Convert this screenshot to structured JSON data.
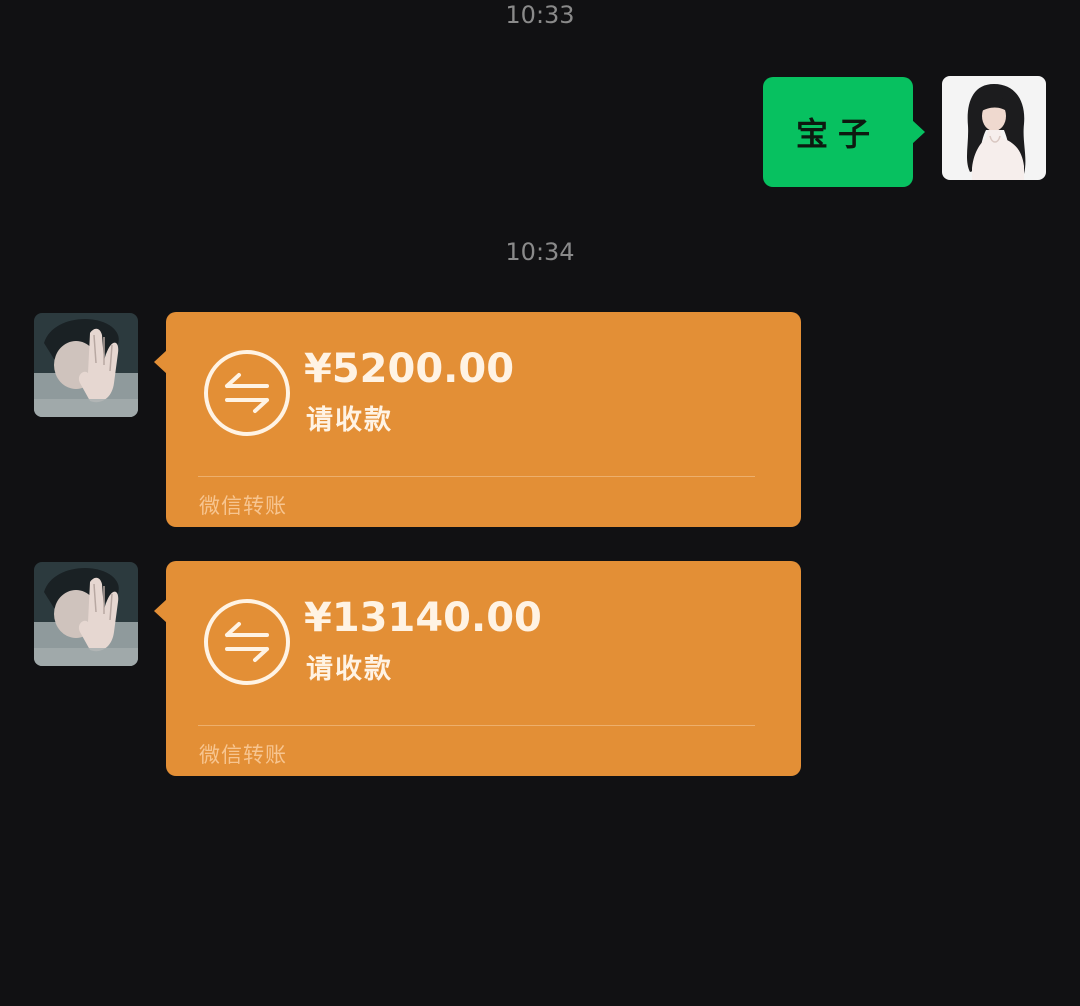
{
  "timestamps": [
    "10:33",
    "10:34"
  ],
  "messages": {
    "outgoing_text": "宝子",
    "transfers": [
      {
        "amount": "¥5200.00",
        "status": "请收款",
        "footer": "微信转账"
      },
      {
        "amount": "¥13140.00",
        "status": "请收款",
        "footer": "微信转账"
      }
    ]
  },
  "colors": {
    "background": "#111113",
    "outgoing_bubble": "#07c160",
    "transfer_card": "#e38f36",
    "timestamp_text": "#8a8a8a"
  },
  "icons": {
    "transfer": "transfer-arrows-icon",
    "self_avatar": "avatar-photo",
    "peer_avatar": "avatar-photo"
  }
}
